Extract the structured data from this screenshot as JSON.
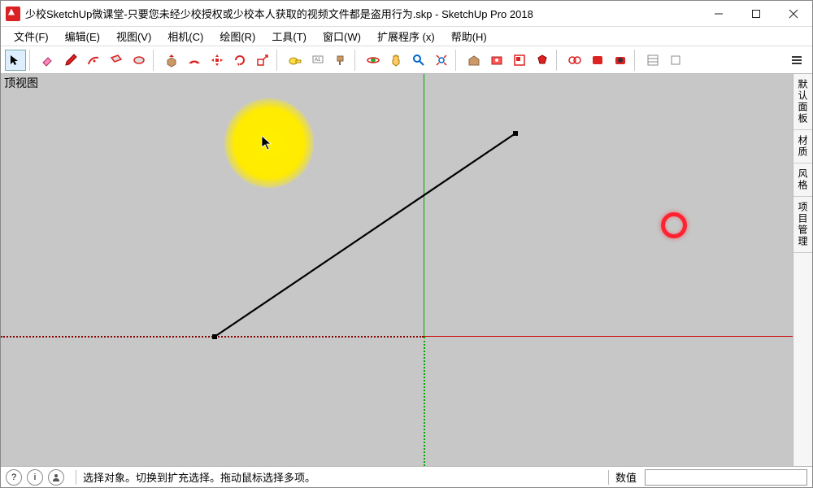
{
  "title": "少校SketchUp微课堂-只要您未经少校授权或少校本人获取的视频文件都是盗用行为.skp - SketchUp Pro 2018",
  "menu": {
    "file": "文件(F)",
    "edit": "编辑(E)",
    "view": "视图(V)",
    "camera": "相机(C)",
    "draw": "绘图(R)",
    "tools": "工具(T)",
    "window": "窗口(W)",
    "extensions": "扩展程序 (x)",
    "help": "帮助(H)"
  },
  "viewport": {
    "label": "顶视图"
  },
  "tray": {
    "default_panel": "默认面板",
    "materials": "材质",
    "styles": "风格",
    "proj_mgmt": "项目管理"
  },
  "status": {
    "hint": "选择对象。切换到扩充选择。拖动鼠标选择多项。",
    "measure_label": "数值"
  },
  "tools": {
    "select": "select",
    "eraser": "eraser",
    "pencil": "pencil",
    "arc": "arc",
    "rect": "rect",
    "circle": "circle",
    "pushpull": "pushpull",
    "offset": "offset",
    "move": "move",
    "rotate": "rotate",
    "scale": "scale",
    "tape": "tape",
    "text": "text",
    "paint": "paint",
    "orbit": "orbit",
    "pan": "pan",
    "zoom": "zoom",
    "zoomext": "zoomext",
    "warehouse": "warehouse",
    "extmgr": "extmgr",
    "layout": "layout",
    "stylebuild": "stylebuild"
  }
}
